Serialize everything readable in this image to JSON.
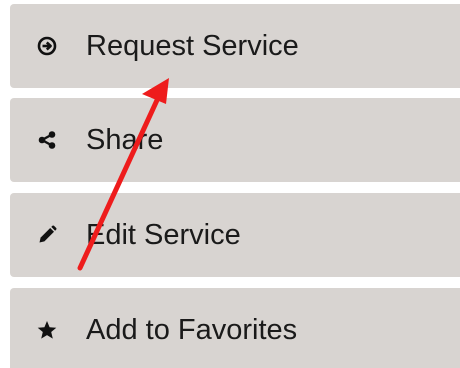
{
  "actions": [
    {
      "label": "Request Service",
      "icon": "circle-arrow-right-icon"
    },
    {
      "label": "Share",
      "icon": "share-icon"
    },
    {
      "label": "Edit Service",
      "icon": "pencil-icon"
    },
    {
      "label": "Add to Favorites",
      "icon": "star-icon"
    }
  ],
  "colors": {
    "button_bg": "#d8d4d1",
    "text": "#1a1a1a",
    "annotation_arrow": "#ee1c1c"
  }
}
